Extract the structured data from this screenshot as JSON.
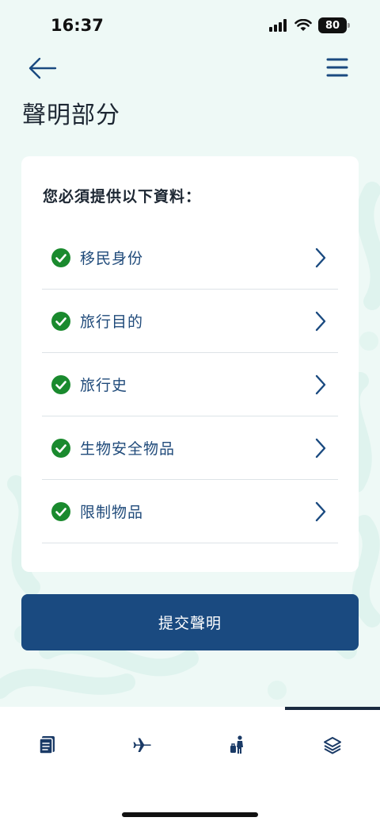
{
  "status_bar": {
    "time": "16:37",
    "battery": "80"
  },
  "header": {
    "title": "聲明部分"
  },
  "card": {
    "heading": "您必須提供以下資料：",
    "items": [
      {
        "label": "移民身份",
        "status": "complete"
      },
      {
        "label": "旅行目的",
        "status": "complete"
      },
      {
        "label": "旅行史",
        "status": "complete"
      },
      {
        "label": "生物安全物品",
        "status": "complete"
      },
      {
        "label": "限制物品",
        "status": "complete"
      }
    ]
  },
  "submit": {
    "label": "提交聲明"
  },
  "tab_bar": {
    "tabs": [
      {
        "icon": "document-icon"
      },
      {
        "icon": "airplane-icon"
      },
      {
        "icon": "traveler-icon"
      },
      {
        "icon": "layers-icon",
        "active": true
      }
    ]
  },
  "colors": {
    "primary": "#1a4a80",
    "check": "#1a8a2e",
    "background": "#eef9f6"
  }
}
